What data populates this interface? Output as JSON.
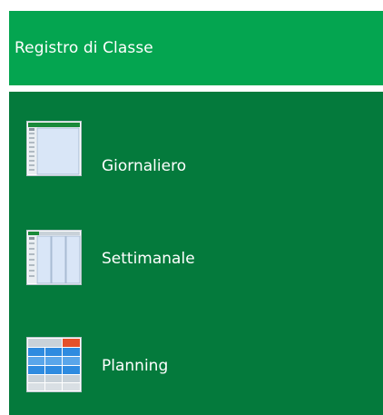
{
  "header": {
    "title": "Registro di Classe"
  },
  "menu": {
    "items": [
      {
        "label": "Giornaliero",
        "icon": "daily-register-icon"
      },
      {
        "label": "Settimanale",
        "icon": "weekly-register-icon"
      },
      {
        "label": "Planning",
        "icon": "planning-grid-icon"
      }
    ]
  },
  "colors": {
    "header_background": "#04a550",
    "menu_background": "#047a3c",
    "text": "#ffffff",
    "icon_accent_green": "#1a8a3a",
    "icon_accent_red": "#e4512a",
    "icon_blue": "#2e8be0"
  }
}
